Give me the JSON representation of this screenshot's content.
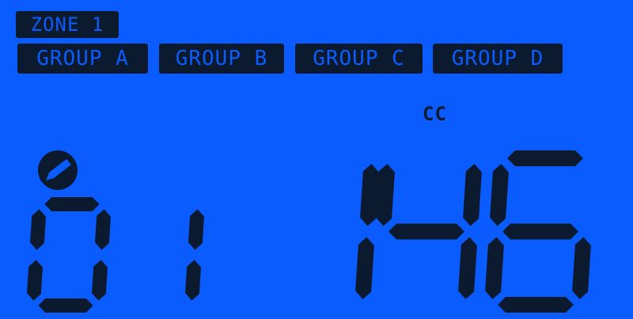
{
  "display": {
    "zone": "ZONE 1",
    "groups": [
      "GROUP A",
      "GROUP B",
      "GROUP C",
      "GROUP D"
    ],
    "unit": "CC",
    "left_digits": "01",
    "value": "146"
  },
  "colors": {
    "background": "#0a5cff",
    "segment": "#0b1a2e"
  },
  "icons": {
    "indicator": "pencil-indicator-icon"
  }
}
